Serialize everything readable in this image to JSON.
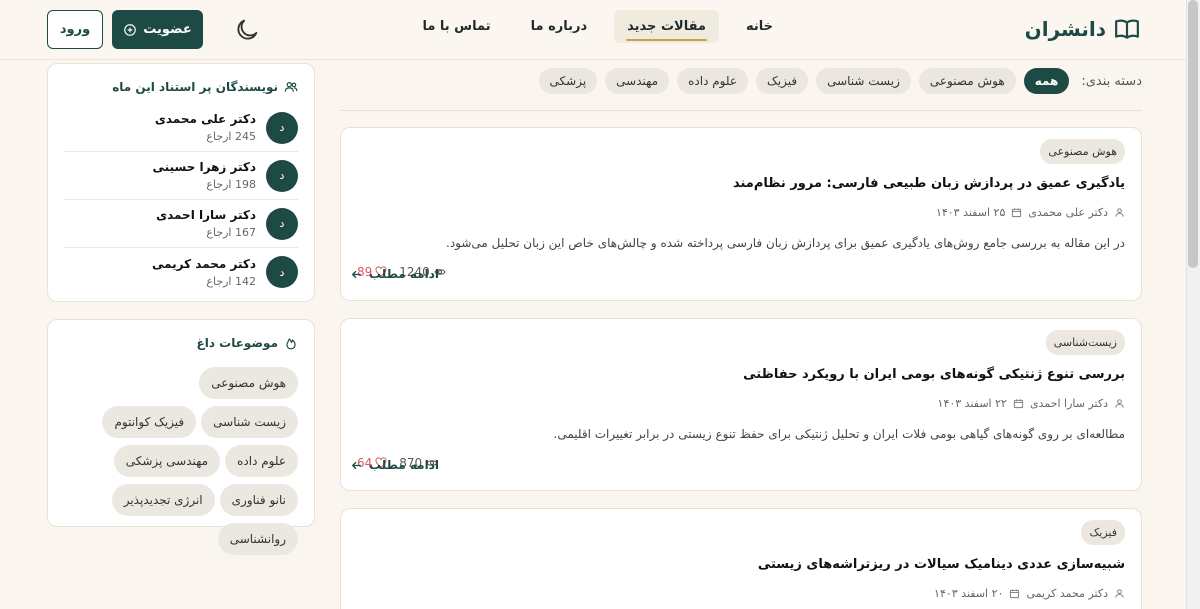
{
  "header": {
    "brand": "دانشران",
    "nav": [
      {
        "label": "خانه",
        "active": false
      },
      {
        "label": "مقالات جدید",
        "active": true
      },
      {
        "label": "درباره ما",
        "active": false
      },
      {
        "label": "تماس با ما",
        "active": false
      }
    ],
    "join_label": "عضویت",
    "login_label": "ورود"
  },
  "filters": {
    "label": "دسته بندی:",
    "items": [
      {
        "label": "همه",
        "active": true
      },
      {
        "label": "هوش مصنوعی",
        "active": false
      },
      {
        "label": "زیست شناسی",
        "active": false
      },
      {
        "label": "فیزیک",
        "active": false
      },
      {
        "label": "علوم داده",
        "active": false
      },
      {
        "label": "مهندسی",
        "active": false
      },
      {
        "label": "پزشکی",
        "active": false
      }
    ]
  },
  "articles": [
    {
      "tag": "هوش مصنوعی",
      "title": "یادگیری عمیق در پردازش زبان طبیعی فارسی: مرور نظام‌مند",
      "author": "دکتر علی محمدی",
      "date": "۲۵ اسفند ۱۴۰۳",
      "excerpt": "در این مقاله به بررسی جامع روش‌های یادگیری عمیق برای پردازش زبان فارسی پرداخته شده و چالش‌های خاص این زبان تحلیل می‌شود.",
      "views": "1240",
      "likes": "89",
      "read_more": "ادامه مطلب"
    },
    {
      "tag": "زیست‌شناسی",
      "title": "بررسی تنوع ژنتیکی گونه‌های بومی ایران با رویکرد حفاظتی",
      "author": "دکتر سارا احمدی",
      "date": "۲۲ اسفند ۱۴۰۳",
      "excerpt": "مطالعه‌ای بر روی گونه‌های گیاهی بومی فلات ایران و تحلیل ژنتیکی برای حفظ تنوع زیستی در برابر تغییرات اقلیمی.",
      "views": "870",
      "likes": "64",
      "read_more": "ادامه مطلب"
    },
    {
      "tag": "فیزیک",
      "title": "شبیه‌سازی عددی دینامیک سیالات در ریزتراشه‌های زیستی",
      "author": "دکتر محمد کریمی",
      "date": "۲۰ اسفند ۱۴۰۳"
    }
  ],
  "top_writers": {
    "title": "نویسندگان پر استناد این ماه",
    "items": [
      {
        "avatar": "د",
        "name": "دکتر علی محمدی",
        "refs": "245 ارجاع"
      },
      {
        "avatar": "د",
        "name": "دکتر زهرا حسینی",
        "refs": "198 ارجاع"
      },
      {
        "avatar": "د",
        "name": "دکتر سارا احمدی",
        "refs": "167 ارجاع"
      },
      {
        "avatar": "د",
        "name": "دکتر محمد کریمی",
        "refs": "142 ارجاع"
      }
    ]
  },
  "hot_topics": {
    "title": "موضوعات داغ",
    "items": [
      "هوش مصنوعی",
      "زیست شناسی",
      "فیزیک کوانتوم",
      "علوم داده",
      "مهندسی پزشکی",
      "نانو فناوری",
      "انرژی تجدیدپذیر",
      "روانشناسی"
    ]
  },
  "colors": {
    "primary": "#1d4a45",
    "accent": "#c8a24a",
    "like": "#d6595c",
    "background": "#faf6ef"
  }
}
